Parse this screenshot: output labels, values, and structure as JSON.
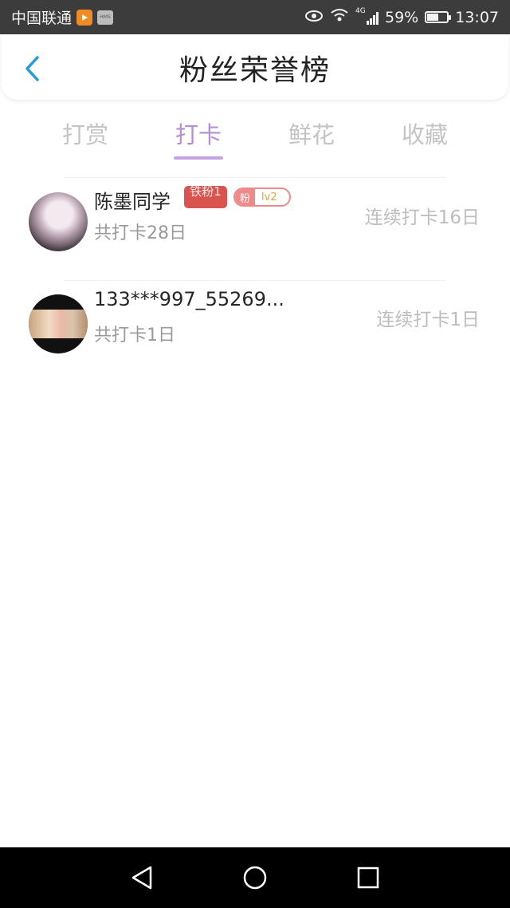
{
  "status_bar": {
    "carrier": "中国联通",
    "app_icon_2_text": "HMS",
    "network": "4G",
    "battery_percent": "59%",
    "battery_level": 0.59,
    "time": "13:07"
  },
  "header": {
    "title": "粉丝荣誉榜"
  },
  "tabs": [
    {
      "label": "打赏",
      "active": false
    },
    {
      "label": "打卡",
      "active": true
    },
    {
      "label": "鲜花",
      "active": false
    },
    {
      "label": "收藏",
      "active": false
    }
  ],
  "list": [
    {
      "name": "陈墨同学",
      "badge_title": "铁粉1",
      "fan_badge_left": "粉",
      "fan_badge_level": "lv2",
      "total": "共打卡28日",
      "streak": "连续打卡16日"
    },
    {
      "name": "133***997_55269...",
      "total": "共打卡1日",
      "streak": "连续打卡1日"
    }
  ],
  "colors": {
    "accent": "#b58ed6",
    "back_arrow": "#2d9cdb",
    "badge_red": "#d9534f"
  }
}
